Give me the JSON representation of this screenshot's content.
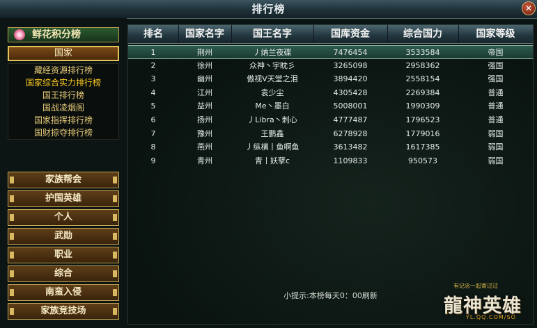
{
  "window": {
    "title": "排行榜",
    "close_symbol": "✕"
  },
  "sidebar": {
    "flower_button": {
      "label": "鲜花积分榜",
      "icon": "flower-icon"
    },
    "country_button": {
      "label": "国家"
    },
    "submenu": [
      {
        "label": "藏经资源排行榜"
      },
      {
        "label": "国家综合实力排行榜",
        "active": true
      },
      {
        "label": "国王排行榜"
      },
      {
        "label": "国战凌烟阁"
      },
      {
        "label": "国家指挥排行榜"
      },
      {
        "label": "国财掠夺排行榜"
      }
    ],
    "categories": [
      {
        "label": "家族帮会"
      },
      {
        "label": "护国英雄"
      },
      {
        "label": "个人"
      },
      {
        "label": "武勋"
      },
      {
        "label": "职业"
      },
      {
        "label": "综合"
      },
      {
        "label": "南蛮入侵"
      },
      {
        "label": "家族竞技场"
      }
    ]
  },
  "table": {
    "columns": [
      "排名",
      "国家名字",
      "国王名字",
      "国库资金",
      "综合国力",
      "国家等级"
    ],
    "rows": [
      [
        "1",
        "荆州",
        "丿纳兰夜碟",
        "7476454",
        "3533584",
        "帝国"
      ],
      [
        "2",
        "徐州",
        "众神丶宇眈彡",
        "3265098",
        "2958362",
        "强国"
      ],
      [
        "3",
        "幽州",
        "傲视V天堂之泪",
        "3894420",
        "2558154",
        "强国"
      ],
      [
        "4",
        "江州",
        "袁少尘",
        "4305428",
        "2269384",
        "普通"
      ],
      [
        "5",
        "益州",
        "Me丶墨白",
        "5008001",
        "1990309",
        "普通"
      ],
      [
        "6",
        "扬州",
        "丿Libra丶刺心",
        "4777487",
        "1796523",
        "普通"
      ],
      [
        "7",
        "豫州",
        "王鹏鑫",
        "6278928",
        "1779016",
        "弱国"
      ],
      [
        "8",
        "燕州",
        "丿纵横丨鱼啊鱼",
        "3613482",
        "1617385",
        "弱国"
      ],
      [
        "9",
        "青州",
        "青丨妖孽c",
        "1109833",
        "950573",
        "弱国"
      ]
    ],
    "selected_row": 0
  },
  "tip": "小提示:本榜每天0：00刷新",
  "logo": {
    "slogan": "有记念一起寄过过",
    "name": "龍神英雄",
    "url": "YL.QQ.COM/SO"
  }
}
